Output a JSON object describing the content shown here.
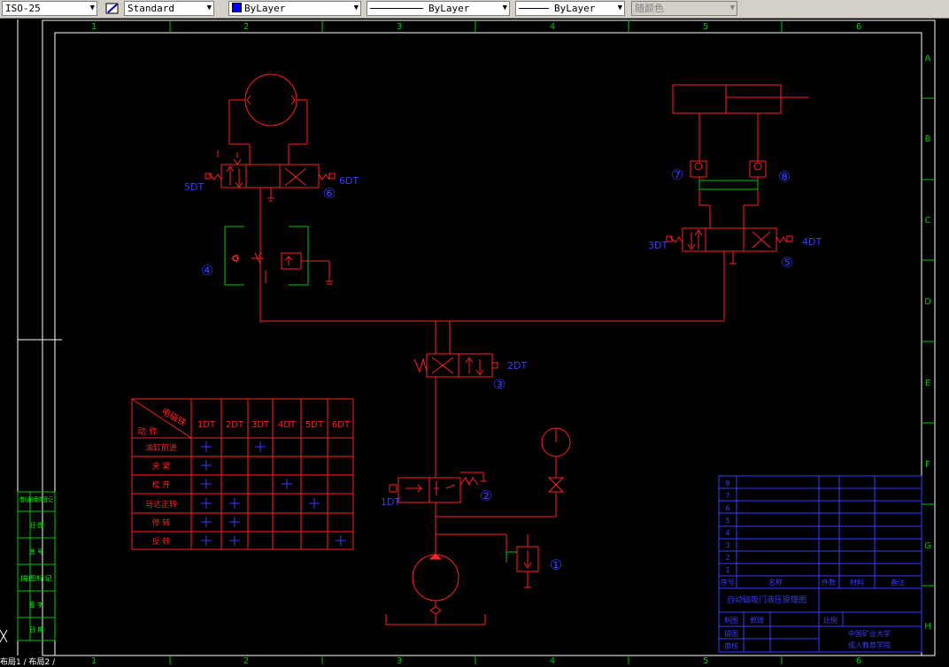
{
  "toolbar": {
    "dimstyle": "ISO-25",
    "textstyle": "Standard",
    "color": "ByLayer",
    "linetype": "ByLayer",
    "lineweight": "ByLayer",
    "plotstyle": "随颜色",
    "color_swatch": "#0000ff"
  },
  "frame": {
    "col_labels": [
      "1",
      "2",
      "3",
      "4",
      "5",
      "6"
    ],
    "row_labels": [
      "A",
      "B",
      "C",
      "D",
      "E",
      "F",
      "G",
      "H"
    ]
  },
  "left_strip": [
    "借(通)用件登记",
    "旧 图",
    "底 号",
    "描图标记",
    "签 字",
    "日 期"
  ],
  "symbols": {
    "labels": [
      "5DT",
      "6DT",
      "3DT",
      "4DT",
      "2DT",
      "1DT"
    ],
    "circles": [
      "⑥",
      "④",
      "⑦",
      "⑧",
      "⑤",
      "③",
      "②",
      "①"
    ]
  },
  "table": {
    "corner_top": "电磁铁",
    "corner_bottom": "动 作",
    "headers": [
      "1DT",
      "2DT",
      "3DT",
      "4DT",
      "5DT",
      "6DT"
    ],
    "rows": [
      {
        "name": "油缸前进",
        "marks": [
          true,
          false,
          true,
          false,
          false,
          false
        ]
      },
      {
        "name": "夹 紧",
        "marks": [
          true,
          false,
          false,
          false,
          false,
          false
        ]
      },
      {
        "name": "松 开",
        "marks": [
          true,
          false,
          false,
          true,
          false,
          false
        ]
      },
      {
        "name": "马达正转",
        "marks": [
          true,
          true,
          false,
          false,
          true,
          false
        ]
      },
      {
        "name": "停 转",
        "marks": [
          true,
          true,
          false,
          false,
          false,
          false
        ]
      },
      {
        "name": "反 转",
        "marks": [
          true,
          true,
          false,
          false,
          false,
          true
        ]
      }
    ]
  },
  "title_block": {
    "row_numbers": [
      "8",
      "7",
      "6",
      "5",
      "4",
      "3",
      "2",
      "1"
    ],
    "header": [
      "序号",
      "名称",
      "件数",
      "材料",
      "备注"
    ],
    "title": "自动磁吸门液压原理图",
    "designer_label": "制图",
    "designer_name": "郭琦",
    "scale_label": "比例",
    "drawn_label": "描图",
    "checked_label": "审核",
    "school": "中国矿业大学",
    "school2": "成人教育学院"
  },
  "status": "布局1 / 布局2 /"
}
